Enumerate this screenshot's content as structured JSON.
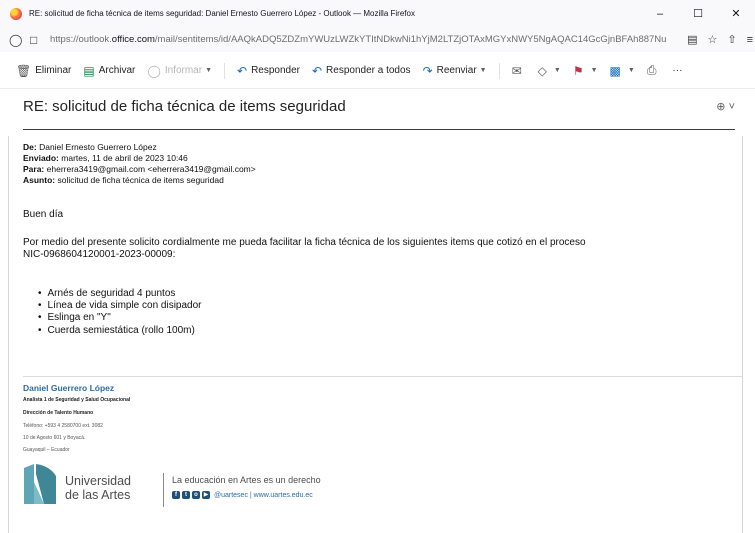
{
  "window": {
    "title": "RE: solicitud de ficha técnica de items seguridad: Daniel Ernesto Guerrero López - Outlook — Mozilla Firefox",
    "minimize": "–",
    "maximize": "☐",
    "close": "✕"
  },
  "urlbar": {
    "url_prefix": "https://outlook.",
    "url_domain": "office.com",
    "url_rest": "/mail/sentitems/id/AAQkADQ5ZDZmYWUzLWZkYTItNDkwNi1hYjM2LTZjOTAxMGYxNWY5NgAQAC14GcGjnBFAh887Nu"
  },
  "toolbar": {
    "delete": "Eliminar",
    "archive": "Archivar",
    "report": "Informar",
    "reply": "Responder",
    "reply_all": "Responder a todos",
    "forward": "Reenviar",
    "more": "···"
  },
  "message": {
    "subject": "RE: solicitud de ficha técnica de items seguridad",
    "from_label": "De:",
    "from_value": "Daniel Ernesto Guerrero López",
    "sent_label": "Enviado:",
    "sent_value": "martes, 11 de abril de 2023 10:46",
    "to_label": "Para:",
    "to_value": "eherrera3419@gmail.com <eherrera3419@gmail.com>",
    "subject_label": "Asunto:",
    "subject_value": "solicitud de ficha técnica de items seguridad",
    "greeting": "Buen día",
    "paragraph_line1": "Por medio del presente solicito cordialmente me pueda facilitar la ficha técnica de los siguientes items que cotizó en el proceso",
    "paragraph_line2": "NIC-0968604120001-2023-00009:",
    "items": [
      "Arnés de seguridad 4 puntos",
      "Línea de vida simple con disipador",
      "Eslinga en \"Y\"",
      "Cuerda semiestática (rollo 100m)"
    ]
  },
  "signature": {
    "name": "Daniel Guerrero López",
    "role": "Analista 1 de Seguridad y Salud Ocupacional",
    "department": "Dirección de Talento Humano",
    "phone": "Teléfono: +593 4 2580700 ext. 3082",
    "address": "10 de Agosto 601 y Boyacá.",
    "city": "Guayaquil – Ecuador",
    "logo_line1": "Universidad",
    "logo_line2": "de las Artes",
    "tagline": "La educación en Artes es un derecho",
    "handle": "@uartesec | www.uartes.edu.ec"
  },
  "colors": {
    "link_blue": "#2b6ca3",
    "brand_navy": "#1f4f7a"
  }
}
